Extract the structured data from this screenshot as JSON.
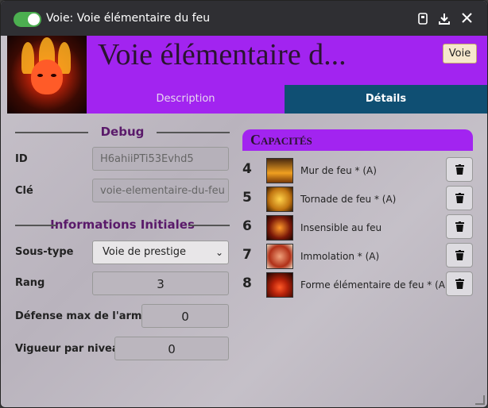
{
  "window": {
    "title": "Voie: Voie élémentaire du feu"
  },
  "header": {
    "name": "Voie élémentaire d...",
    "type_badge": "Voie"
  },
  "tabs": [
    {
      "label": "Description",
      "active": false
    },
    {
      "label": "Détails",
      "active": true
    }
  ],
  "debug": {
    "heading": "Debug",
    "id_label": "ID",
    "id_value": "H6ahiiPTi53Evhd5",
    "key_label": "Clé",
    "key_value": "voie-elementaire-du-feu"
  },
  "info": {
    "heading": "Informations Initiales",
    "subtype_label": "Sous-type",
    "subtype_value": "Voie de prestige",
    "rank_label": "Rang",
    "rank_value": "3",
    "armor_label": "Défense max de l'armure",
    "armor_value": "0",
    "vigor_label": "Vigueur par niveau",
    "vigor_value": "0"
  },
  "capacities": {
    "heading": "Capacités",
    "items": [
      {
        "rank": "4",
        "name": "Mur de feu * (A)"
      },
      {
        "rank": "5",
        "name": "Tornade de feu * (A)"
      },
      {
        "rank": "6",
        "name": "Insensible au feu"
      },
      {
        "rank": "7",
        "name": "Immolation * (A)"
      },
      {
        "rank": "8",
        "name": "Forme élémentaire de feu * (A)"
      }
    ]
  },
  "colors": {
    "accent": "#a224f0",
    "active_tab": "#0f4f73",
    "toggle": "#4caf50"
  },
  "icons": [
    "toggle-switch",
    "book-icon",
    "download-icon",
    "close-icon",
    "trash-icon"
  ]
}
